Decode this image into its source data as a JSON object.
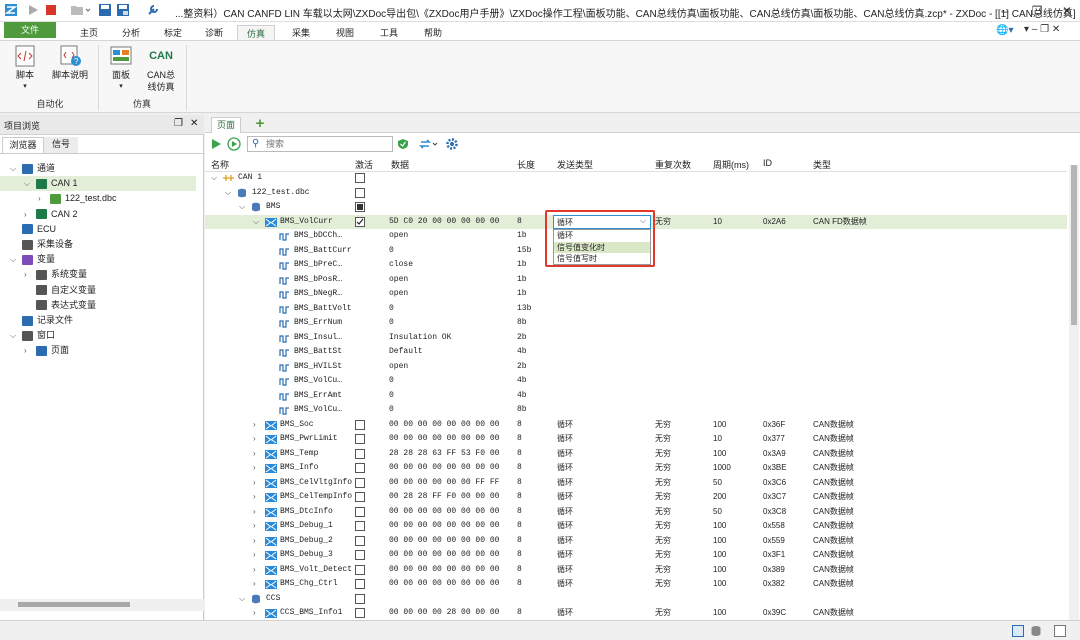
{
  "window": {
    "title": "...整资料）CAN CANFD LIN 车载以太网\\ZXDoc导出包\\《ZXDoc用户手册》\\ZXDoc操作工程\\面板功能、CAN总线仿真\\面板功能、CAN总线仿真\\面板功能、CAN总线仿真.zcp* - ZXDoc - [[1] CAN总线仿真]"
  },
  "menu": {
    "file": "文件",
    "tabs": [
      "主页",
      "分析",
      "标定",
      "诊断",
      "仿真",
      "采集",
      "视图",
      "工具",
      "帮助"
    ],
    "active": "仿真"
  },
  "ribbon": {
    "buttons": [
      {
        "label": "脚本",
        "sub": "",
        "dropdown": true
      },
      {
        "label": "脚本说明",
        "sub": ""
      },
      {
        "label": "面板",
        "sub": "",
        "dropdown": true
      },
      {
        "label": "CAN总",
        "sub": "线仿真"
      }
    ],
    "can_icon_text": "CAN",
    "groups": [
      "自动化",
      "仿真"
    ]
  },
  "left_panel": {
    "title": "项目浏览",
    "tabs": [
      "浏览器",
      "信号"
    ],
    "tree": [
      {
        "label": "通道",
        "indent": 0,
        "arrow": "v",
        "icon": "channel-icon"
      },
      {
        "label": "CAN 1",
        "indent": 1,
        "arrow": "v",
        "icon": "can-icon",
        "selected": true
      },
      {
        "label": "122_test.dbc",
        "indent": 2,
        "arrow": ">",
        "icon": "dbc-icon"
      },
      {
        "label": "CAN 2",
        "indent": 1,
        "arrow": ">",
        "icon": "can-icon"
      },
      {
        "label": "ECU",
        "indent": 0,
        "arrow": "",
        "icon": "ecu-icon"
      },
      {
        "label": "采集设备",
        "indent": 0,
        "arrow": "",
        "icon": "device-icon"
      },
      {
        "label": "变量",
        "indent": 0,
        "arrow": "v",
        "icon": "variable-icon"
      },
      {
        "label": "系统变量",
        "indent": 1,
        "arrow": ">",
        "icon": "var-sub-icon"
      },
      {
        "label": "自定义变量",
        "indent": 1,
        "arrow": "",
        "icon": "var-sub-icon"
      },
      {
        "label": "表达式变量",
        "indent": 1,
        "arrow": "",
        "icon": "var-sub-icon"
      },
      {
        "label": "记录文件",
        "indent": 0,
        "arrow": "",
        "icon": "record-icon"
      },
      {
        "label": "窗口",
        "indent": 0,
        "arrow": "v",
        "icon": "window-icon"
      },
      {
        "label": "页面",
        "indent": 1,
        "arrow": ">",
        "icon": "page-icon"
      }
    ]
  },
  "main": {
    "page_tab": "页面",
    "add_tab": "+",
    "search_placeholder": "搜索",
    "columns": [
      "名称",
      "激活",
      "数据",
      "长度",
      "发送类型",
      "重复次数",
      "周期(ms)",
      "ID",
      "类型"
    ],
    "rows": [
      {
        "indent": 0,
        "arrow": "v",
        "icon": "bus",
        "name": "CAN 1",
        "cb": "empty"
      },
      {
        "indent": 1,
        "arrow": "v",
        "icon": "db",
        "name": "122_test.dbc",
        "cb": "empty"
      },
      {
        "indent": 2,
        "arrow": "v",
        "icon": "db",
        "name": "BMS",
        "cb": "partial"
      },
      {
        "indent": 3,
        "arrow": "v",
        "icon": "msg",
        "name": "BMS_VolCurr",
        "cb": "checked",
        "data": "5D C0 20 00 00 00 00 00",
        "len": "8",
        "send": "",
        "rep": "无穷",
        "period": "10",
        "id": "0x2A6",
        "type": "CAN FD数据帧",
        "selected": true
      },
      {
        "indent": 4,
        "icon": "sig",
        "name": "BMS_bDCCh…",
        "data": " open",
        "len": "1b"
      },
      {
        "indent": 4,
        "icon": "sig",
        "name": "BMS_BattCurr",
        "data": "0",
        "len": "15b"
      },
      {
        "indent": 4,
        "icon": "sig",
        "name": "BMS_bPreC…",
        "data": " close",
        "len": "1b"
      },
      {
        "indent": 4,
        "icon": "sig",
        "name": "BMS_bPosR…",
        "data": " open",
        "len": "1b"
      },
      {
        "indent": 4,
        "icon": "sig",
        "name": "BMS_bNegR…",
        "data": " open",
        "len": "1b"
      },
      {
        "indent": 4,
        "icon": "sig",
        "name": "BMS_BattVolt",
        "data": "0",
        "len": "13b"
      },
      {
        "indent": 4,
        "icon": "sig",
        "name": "BMS_ErrNum",
        "data": "0",
        "len": "8b"
      },
      {
        "indent": 4,
        "icon": "sig",
        "name": "BMS_Insul…",
        "data": " Insulation OK",
        "len": "2b"
      },
      {
        "indent": 4,
        "icon": "sig",
        "name": "BMS_BattSt",
        "data": "  Default",
        "len": "4b"
      },
      {
        "indent": 4,
        "icon": "sig",
        "name": "BMS_HVILSt",
        "data": "open",
        "len": "2b"
      },
      {
        "indent": 4,
        "icon": "sig",
        "name": "BMS_VolCu…",
        "data": "0",
        "len": "4b"
      },
      {
        "indent": 4,
        "icon": "sig",
        "name": "BMS_ErrAmt",
        "data": "0",
        "len": "4b"
      },
      {
        "indent": 4,
        "icon": "sig",
        "name": "BMS_VolCu…",
        "data": "0",
        "len": "8b"
      },
      {
        "indent": 3,
        "arrow": ">",
        "icon": "msg",
        "name": "BMS_Soc",
        "cb": "empty",
        "data": "00 00 00 00 00 00 00 00",
        "len": "8",
        "send": "循环",
        "rep": "无穷",
        "period": "100",
        "id": "0x36F",
        "type": "CAN数据帧"
      },
      {
        "indent": 3,
        "arrow": ">",
        "icon": "msg",
        "name": "BMS_PwrLimit",
        "cb": "empty",
        "data": "00 00 00 00 00 00 00 00",
        "len": "8",
        "send": "循环",
        "rep": "无穷",
        "period": "10",
        "id": "0x377",
        "type": "CAN数据帧"
      },
      {
        "indent": 3,
        "arrow": ">",
        "icon": "msg",
        "name": "BMS_Temp",
        "cb": "empty",
        "data": "28 28 28 63 FF 53 F0 00",
        "len": "8",
        "send": "循环",
        "rep": "无穷",
        "period": "100",
        "id": "0x3A9",
        "type": "CAN数据帧"
      },
      {
        "indent": 3,
        "arrow": ">",
        "icon": "msg",
        "name": "BMS_Info",
        "cb": "empty",
        "data": "00 00 00 00 00 00 00 00",
        "len": "8",
        "send": "循环",
        "rep": "无穷",
        "period": "1000",
        "id": "0x3BE",
        "type": "CAN数据帧"
      },
      {
        "indent": 3,
        "arrow": ">",
        "icon": "msg",
        "name": "BMS_CelVltgInfo",
        "cb": "empty",
        "data": "00 00 00 00 00 00 FF FF",
        "len": "8",
        "send": "循环",
        "rep": "无穷",
        "period": "50",
        "id": "0x3C6",
        "type": "CAN数据帧"
      },
      {
        "indent": 3,
        "arrow": ">",
        "icon": "msg",
        "name": "BMS_CelTempInfo",
        "cb": "empty",
        "data": "00 28 28 FF F0 00 00 00",
        "len": "8",
        "send": "循环",
        "rep": "无穷",
        "period": "200",
        "id": "0x3C7",
        "type": "CAN数据帧"
      },
      {
        "indent": 3,
        "arrow": ">",
        "icon": "msg",
        "name": "BMS_DtcInfo",
        "cb": "empty",
        "data": "00 00 00 00 00 00 00 00",
        "len": "8",
        "send": "循环",
        "rep": "无穷",
        "period": "50",
        "id": "0x3C8",
        "type": "CAN数据帧"
      },
      {
        "indent": 3,
        "arrow": ">",
        "icon": "msg",
        "name": "BMS_Debug_1",
        "cb": "empty",
        "data": "00 00 00 00 00 00 00 00",
        "len": "8",
        "send": "循环",
        "rep": "无穷",
        "period": "100",
        "id": "0x558",
        "type": "CAN数据帧"
      },
      {
        "indent": 3,
        "arrow": ">",
        "icon": "msg",
        "name": "BMS_Debug_2",
        "cb": "empty",
        "data": "00 00 00 00 00 00 00 00",
        "len": "8",
        "send": "循环",
        "rep": "无穷",
        "period": "100",
        "id": "0x559",
        "type": "CAN数据帧"
      },
      {
        "indent": 3,
        "arrow": ">",
        "icon": "msg",
        "name": "BMS_Debug_3",
        "cb": "empty",
        "data": "00 00 00 00 00 00 00 00",
        "len": "8",
        "send": "循环",
        "rep": "无穷",
        "period": "100",
        "id": "0x3F1",
        "type": "CAN数据帧"
      },
      {
        "indent": 3,
        "arrow": ">",
        "icon": "msg",
        "name": "BMS_Volt_Detect",
        "cb": "empty",
        "data": "00 00 00 00 00 00 00 00",
        "len": "8",
        "send": "循环",
        "rep": "无穷",
        "period": "100",
        "id": "0x389",
        "type": "CAN数据帧"
      },
      {
        "indent": 3,
        "arrow": ">",
        "icon": "msg",
        "name": "BMS_Chg_Ctrl",
        "cb": "empty",
        "data": "00 00 00 00 00 00 00 00",
        "len": "8",
        "send": "循环",
        "rep": "无穷",
        "period": "100",
        "id": "0x382",
        "type": "CAN数据帧"
      },
      {
        "indent": 2,
        "arrow": "v",
        "icon": "db",
        "name": "CCS",
        "cb": "empty"
      },
      {
        "indent": 3,
        "arrow": ">",
        "icon": "msg",
        "name": "CCS_BMS_Info1",
        "cb": "empty",
        "data": "00 00 00 00 28 00 00 00",
        "len": "8",
        "send": "循环",
        "rep": "无穷",
        "period": "100",
        "id": "0x39C",
        "type": "CAN数据帧"
      }
    ],
    "dropdown": {
      "value": "循环",
      "options": [
        "循环",
        "信号值变化时",
        "信号值写时"
      ],
      "hover": "信号值变化时"
    }
  },
  "colors": {
    "accent_green": "#4e9a3c",
    "highlight_red": "#e0392b",
    "selected_row": "#e3eed9",
    "message_icon_blue": "#2a8ad8"
  }
}
